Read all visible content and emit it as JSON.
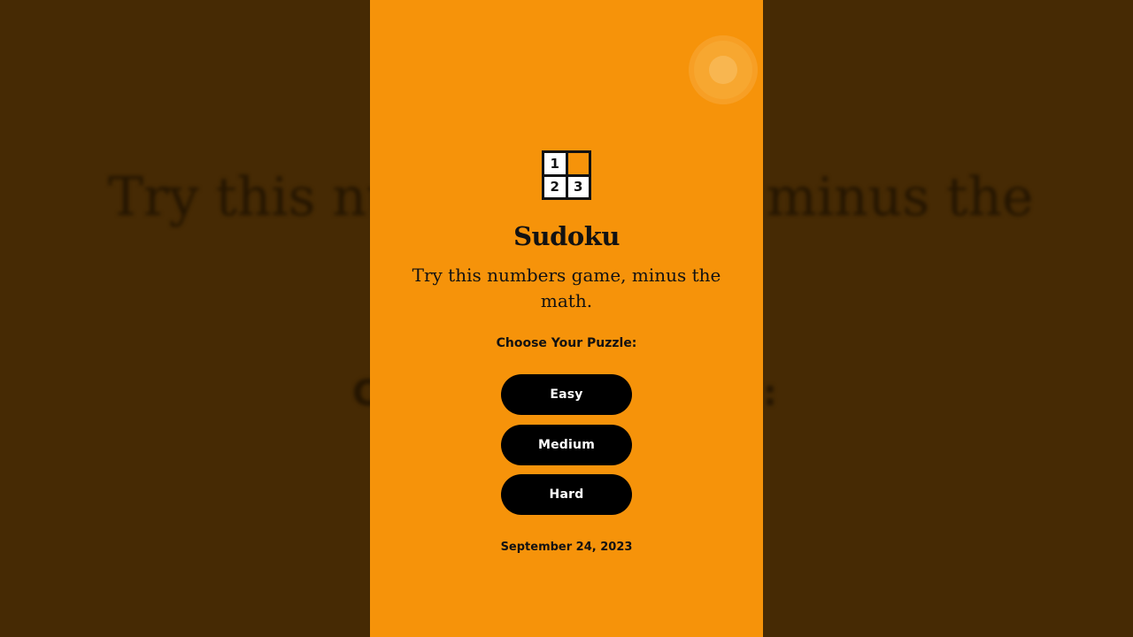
{
  "backdrop": {
    "subtitle_left": "Try this nu",
    "subtitle_right": "minus the",
    "choose_left": "C",
    "choose_right": ":"
  },
  "logo": {
    "cells": [
      "1",
      "",
      "2",
      "3"
    ]
  },
  "app": {
    "title": "Sudoku",
    "subtitle": "Try this numbers game, minus the math.",
    "choose_label": "Choose Your Puzzle:",
    "buttons": {
      "easy": "Easy",
      "medium": "Medium",
      "hard": "Hard"
    },
    "date": "September 24, 2023"
  },
  "colors": {
    "accent": "#f6930a",
    "button": "#000000",
    "backdrop": "#462a04"
  }
}
